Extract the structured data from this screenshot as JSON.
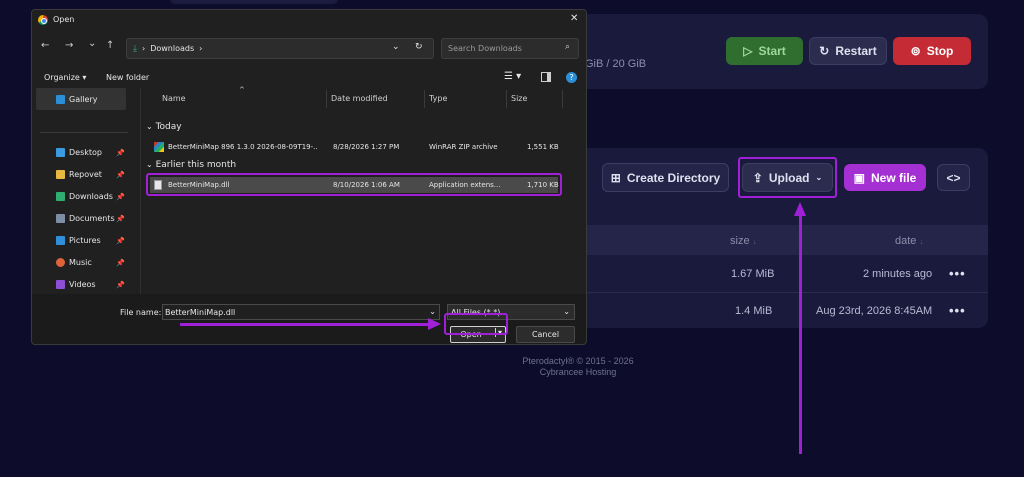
{
  "app": {
    "resources": {
      "disk_text": "GiB / 20 GiB"
    },
    "power": {
      "start": "Start",
      "restart": "Restart",
      "stop": "Stop"
    },
    "file_actions": {
      "create_dir": "Create Directory",
      "upload": "Upload",
      "new_file": "New file",
      "code_icon": "<>"
    },
    "table": {
      "headers": {
        "size": "size",
        "date": "date",
        "sort_mark": "↓"
      },
      "rows": [
        {
          "size": "1.67 MiB",
          "date": "2 minutes ago",
          "menu": "•••"
        },
        {
          "size": "1.4 MiB",
          "date": "Aug 23rd, 2026 8:45AM",
          "menu": "•••"
        }
      ]
    },
    "footer": {
      "line1": "Pterodactyl® © 2015 - 2026",
      "line2": "Cybrancee Hosting"
    }
  },
  "dialog": {
    "title": "Open",
    "close": "✕",
    "nav": {
      "back": "←",
      "forward": "→",
      "down": "⌄",
      "up": "↑",
      "refresh": "↻"
    },
    "address": {
      "crumb": "Downloads",
      "sep": "›"
    },
    "search_placeholder": "Search Downloads",
    "toolbar": {
      "organize": "Organize",
      "new_folder": "New folder",
      "help": "?"
    },
    "sidebar": [
      {
        "label": "Gallery",
        "color": "#2b8fd6"
      },
      {
        "label": "Desktop",
        "color": "#3a9be0"
      },
      {
        "label": "Repovet",
        "color": "#e6b840"
      },
      {
        "label": "Downloads",
        "color": "#2fae72"
      },
      {
        "label": "Documents",
        "color": "#7d8da6"
      },
      {
        "label": "Pictures",
        "color": "#2f8fd8"
      },
      {
        "label": "Music",
        "color": "#e0623a"
      },
      {
        "label": "Videos",
        "color": "#8e4ed6"
      }
    ],
    "columns": {
      "name": "Name",
      "modified": "Date modified",
      "type": "Type",
      "size": "Size"
    },
    "groups": {
      "today": "Today",
      "earlier": "Earlier this month"
    },
    "files": [
      {
        "name": "BetterMiniMap 896 1.3.0 2026-08-09T19-...",
        "modified": "8/28/2026 1:27 PM",
        "type": "WinRAR ZIP archive",
        "size": "1,551 KB"
      },
      {
        "name": "BetterMiniMap.dll",
        "modified": "8/10/2026 1:06 AM",
        "type": "Application extens...",
        "size": "1,710 KB"
      }
    ],
    "filename_label": "File name:",
    "filename_value": "BetterMiniMap.dll",
    "filetype_value": "All Files (*.*)",
    "open_label": "Open",
    "cancel_label": "Cancel"
  }
}
